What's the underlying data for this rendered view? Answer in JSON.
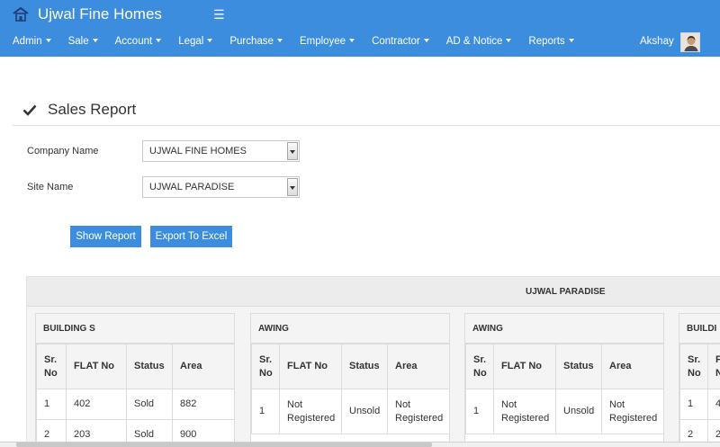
{
  "app": {
    "title": "Ujwal Fine Homes",
    "accent_color": "#3c8dde",
    "logo_icon": "house-logo-icon",
    "menu_icon": "hamburger-icon"
  },
  "nav": {
    "items": [
      {
        "label": "Admin"
      },
      {
        "label": "Sale"
      },
      {
        "label": "Account"
      },
      {
        "label": "Legal"
      },
      {
        "label": "Purchase"
      },
      {
        "label": "Employee"
      },
      {
        "label": "Contractor"
      },
      {
        "label": "AD & Notice"
      },
      {
        "label": "Reports"
      }
    ],
    "user_name": "Akshay"
  },
  "page": {
    "title": "Sales Report",
    "title_icon": "checkmark-icon"
  },
  "form": {
    "company_label": "Company Name",
    "company_value": "UJWAL FINE HOMES",
    "site_label": "Site Name",
    "site_value": "UJWAL PARADISE",
    "show_report_label": "Show Report",
    "export_label": "Export To Excel"
  },
  "report": {
    "site_name": "UJWAL PARADISE",
    "columns": {
      "sr_no_line1": "Sr.",
      "sr_no_line2": "No",
      "flat_no": "FLAT No",
      "status": "Status",
      "area": "Area"
    },
    "buildings": [
      {
        "name": "BUILDING S",
        "rows": [
          {
            "sr": "1",
            "flat": "402",
            "status": "Sold",
            "area": "882"
          },
          {
            "sr": "2",
            "flat": "203",
            "status": "Sold",
            "area": "900"
          }
        ]
      },
      {
        "name": "AWING",
        "rows": [
          {
            "sr": "1",
            "flat_line1": "Not",
            "flat_line2": "Registered",
            "status": "Unsold",
            "area_line1": "Not",
            "area_line2": "Registered"
          }
        ]
      },
      {
        "name": "AWING",
        "rows": [
          {
            "sr": "1",
            "flat_line1": "Not",
            "flat_line2": "Registered",
            "status": "Unsold",
            "area_line1": "Not",
            "area_line2": "Registered"
          }
        ]
      },
      {
        "name": "BUILDI",
        "rows": [
          {
            "sr": "1",
            "flat": "4"
          },
          {
            "sr": "2",
            "flat": "2"
          }
        ]
      }
    ]
  }
}
